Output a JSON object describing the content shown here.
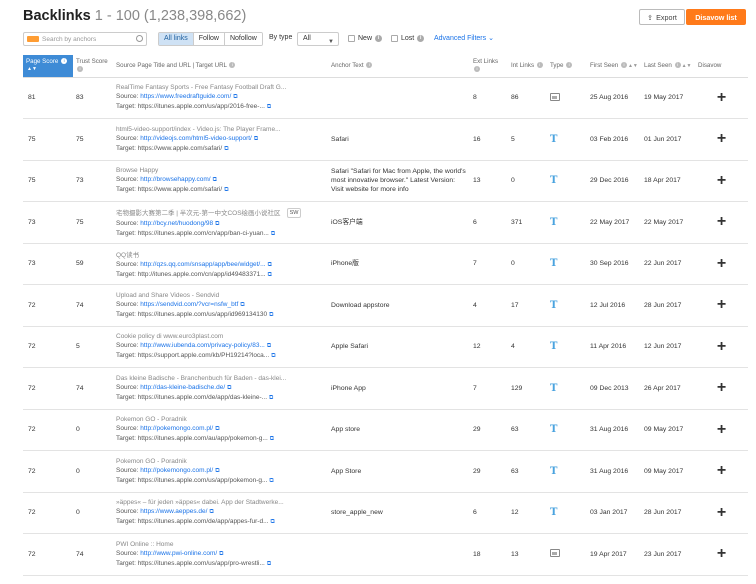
{
  "header": {
    "title": "Backlinks",
    "range": "1 - 100 (1,238,398,662)",
    "export_label": "Export",
    "disavow_label": "Disavow list"
  },
  "filters": {
    "search_placeholder": "Search by anchors",
    "segments": [
      "All links",
      "Follow",
      "Nofollow"
    ],
    "by_type_label": "By type",
    "type_select": "All",
    "new_label": "New",
    "lost_label": "Lost",
    "advanced_label": "Advanced Filters"
  },
  "columns": {
    "page_score": "Page Score",
    "trust_score": "Trust Score",
    "source": "Source Page Title and URL | Target URL",
    "anchor": "Anchor Text",
    "ext": "Ext Links",
    "int": "Int Links",
    "type": "Type",
    "first": "First Seen",
    "last": "Last Seen",
    "disavow": "Disavow"
  },
  "rows": [
    {
      "ps": "81",
      "ts": "83",
      "title": "RealTime Fantasy Sports - Free Fantasy Football Draft G...",
      "source_label": "Source:",
      "source": "https://www.freedraftguide.com/",
      "target_label": "Target:",
      "target": "https://itunes.apple.com/us/app/2016-free-...",
      "anchor": "",
      "sw": "",
      "ext": "8",
      "int": "86",
      "type": "image",
      "first": "25 Aug 2016",
      "last": "19 May 2017"
    },
    {
      "ps": "75",
      "ts": "75",
      "title": "html5-video-support/index - Video.js: The Player Frame...",
      "source_label": "Source:",
      "source": "http://videojs.com/html5-video-support/",
      "target_label": "Target:",
      "target": "https://www.apple.com/safari/",
      "anchor": "Safari",
      "sw": "",
      "ext": "16",
      "int": "5",
      "type": "text",
      "first": "03 Feb 2016",
      "last": "01 Jun 2017"
    },
    {
      "ps": "75",
      "ts": "73",
      "title": "Browse Happy",
      "source_label": "Source:",
      "source": "http://browsehappy.com/",
      "target_label": "Target:",
      "target": "https://www.apple.com/safari/",
      "anchor": "Safari \"Safari for Mac from Apple, the world's most innovative browser.\" Latest Version: Visit website for more info",
      "sw": "",
      "ext": "13",
      "int": "0",
      "type": "text",
      "first": "29 Dec 2016",
      "last": "18 Apr 2017"
    },
    {
      "ps": "73",
      "ts": "75",
      "title": "宅物摄影大赛第二季 | 半次元-第一中文COS绘画小说社区",
      "source_label": "Source:",
      "source": "http://bcy.net/huodong/98",
      "target_label": "Target:",
      "target": "https://itunes.apple.com/cn/app/ban-ci-yuan...",
      "anchor": "iOS客户端",
      "sw": "SW",
      "ext": "6",
      "int": "371",
      "type": "text",
      "first": "22 May 2017",
      "last": "22 May 2017"
    },
    {
      "ps": "73",
      "ts": "59",
      "title": "QQ读书",
      "source_label": "Source:",
      "source": "http://qzs.qq.com/snsapp/app/bee/widget/...",
      "target_label": "Target:",
      "target": "http://itunes.apple.com/cn/app/id49483371...",
      "anchor": "iPhone版",
      "sw": "",
      "ext": "7",
      "int": "0",
      "type": "text",
      "first": "30 Sep 2016",
      "last": "22 Jun 2017"
    },
    {
      "ps": "72",
      "ts": "74",
      "title": "Upload and Share Videos - Sendvid",
      "source_label": "Source:",
      "source": "https://sendvid.com/?vcr=nsfw_btf",
      "target_label": "Target:",
      "target": "https://itunes.apple.com/us/app/id969134130",
      "anchor": "Download appstore",
      "sw": "",
      "ext": "4",
      "int": "17",
      "type": "text",
      "first": "12 Jul 2016",
      "last": "28 Jun 2017"
    },
    {
      "ps": "72",
      "ts": "5",
      "title": "Cookie policy di www.euro3plast.com",
      "source_label": "Source:",
      "source": "http://www.iubenda.com/privacy-policy/83...",
      "target_label": "Target:",
      "target": "https://support.apple.com/kb/PH19214?loca...",
      "anchor": "Apple Safari",
      "sw": "",
      "ext": "12",
      "int": "4",
      "type": "text",
      "first": "11 Apr 2016",
      "last": "12 Jun 2017"
    },
    {
      "ps": "72",
      "ts": "74",
      "title": "Das kleine Badische - Branchenbuch für Baden - das-klei...",
      "source_label": "Source:",
      "source": "http://das-kleine-badische.de/",
      "target_label": "Target:",
      "target": "https://itunes.apple.com/de/app/das-kleine-...",
      "anchor": "iPhone App",
      "sw": "",
      "ext": "7",
      "int": "129",
      "type": "text",
      "first": "09 Dec 2013",
      "last": "26 Apr 2017"
    },
    {
      "ps": "72",
      "ts": "0",
      "title": "Pokemon GO - Poradnik",
      "source_label": "Source:",
      "source": "http://pokemongo.com.pl/",
      "target_label": "Target:",
      "target": "https://itunes.apple.com/au/app/pokemon-g...",
      "anchor": "App store",
      "sw": "",
      "ext": "29",
      "int": "63",
      "type": "text",
      "first": "31 Aug 2016",
      "last": "09 May 2017"
    },
    {
      "ps": "72",
      "ts": "0",
      "title": "Pokemon GO - Poradnik",
      "source_label": "Source:",
      "source": "http://pokemongo.com.pl/",
      "target_label": "Target:",
      "target": "https://itunes.apple.com/us/app/pokemon-g...",
      "anchor": "App Store",
      "sw": "",
      "ext": "29",
      "int": "63",
      "type": "text",
      "first": "31 Aug 2016",
      "last": "09 May 2017"
    },
    {
      "ps": "72",
      "ts": "0",
      "title": "»äppes« – für jeden »äppes« dabei. App der Stadtwerke...",
      "source_label": "Source:",
      "source": "https://www.aeppes.de/",
      "target_label": "Target:",
      "target": "https://itunes.apple.com/de/app/appes-fur-d...",
      "anchor": "store_apple_new",
      "sw": "",
      "ext": "6",
      "int": "12",
      "type": "text",
      "first": "03 Jan 2017",
      "last": "28 Jun 2017"
    },
    {
      "ps": "72",
      "ts": "74",
      "title": "PWI Online :: Home",
      "source_label": "Source:",
      "source": "http://www.pwi-online.com/",
      "target_label": "Target:",
      "target": "https://itunes.apple.com/us/app/pro-wrestli...",
      "anchor": "",
      "sw": "",
      "ext": "18",
      "int": "13",
      "type": "image",
      "first": "19 Apr 2017",
      "last": "23 Jun 2017"
    }
  ]
}
